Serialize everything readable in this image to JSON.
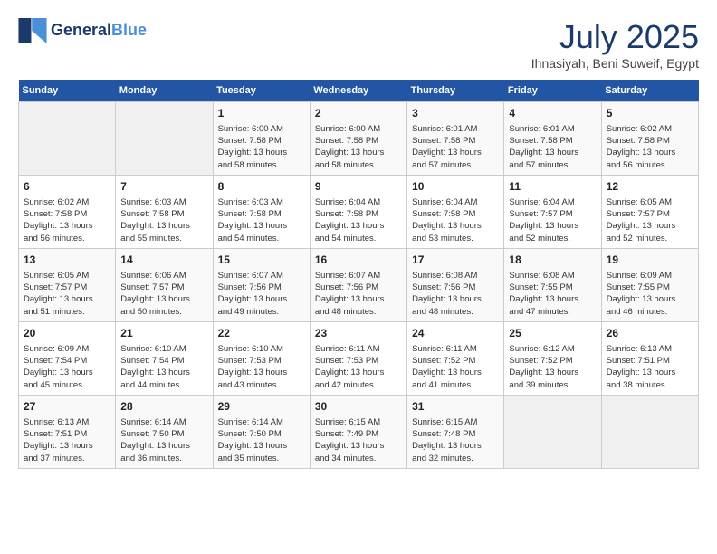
{
  "logo": {
    "line1": "General",
    "line2": "Blue"
  },
  "title": "July 2025",
  "location": "Ihnasiyah, Beni Suweif, Egypt",
  "days_of_week": [
    "Sunday",
    "Monday",
    "Tuesday",
    "Wednesday",
    "Thursday",
    "Friday",
    "Saturday"
  ],
  "weeks": [
    [
      {
        "day": "",
        "info": ""
      },
      {
        "day": "",
        "info": ""
      },
      {
        "day": "1",
        "info": "Sunrise: 6:00 AM\nSunset: 7:58 PM\nDaylight: 13 hours\nand 58 minutes."
      },
      {
        "day": "2",
        "info": "Sunrise: 6:00 AM\nSunset: 7:58 PM\nDaylight: 13 hours\nand 58 minutes."
      },
      {
        "day": "3",
        "info": "Sunrise: 6:01 AM\nSunset: 7:58 PM\nDaylight: 13 hours\nand 57 minutes."
      },
      {
        "day": "4",
        "info": "Sunrise: 6:01 AM\nSunset: 7:58 PM\nDaylight: 13 hours\nand 57 minutes."
      },
      {
        "day": "5",
        "info": "Sunrise: 6:02 AM\nSunset: 7:58 PM\nDaylight: 13 hours\nand 56 minutes."
      }
    ],
    [
      {
        "day": "6",
        "info": "Sunrise: 6:02 AM\nSunset: 7:58 PM\nDaylight: 13 hours\nand 56 minutes."
      },
      {
        "day": "7",
        "info": "Sunrise: 6:03 AM\nSunset: 7:58 PM\nDaylight: 13 hours\nand 55 minutes."
      },
      {
        "day": "8",
        "info": "Sunrise: 6:03 AM\nSunset: 7:58 PM\nDaylight: 13 hours\nand 54 minutes."
      },
      {
        "day": "9",
        "info": "Sunrise: 6:04 AM\nSunset: 7:58 PM\nDaylight: 13 hours\nand 54 minutes."
      },
      {
        "day": "10",
        "info": "Sunrise: 6:04 AM\nSunset: 7:58 PM\nDaylight: 13 hours\nand 53 minutes."
      },
      {
        "day": "11",
        "info": "Sunrise: 6:04 AM\nSunset: 7:57 PM\nDaylight: 13 hours\nand 52 minutes."
      },
      {
        "day": "12",
        "info": "Sunrise: 6:05 AM\nSunset: 7:57 PM\nDaylight: 13 hours\nand 52 minutes."
      }
    ],
    [
      {
        "day": "13",
        "info": "Sunrise: 6:05 AM\nSunset: 7:57 PM\nDaylight: 13 hours\nand 51 minutes."
      },
      {
        "day": "14",
        "info": "Sunrise: 6:06 AM\nSunset: 7:57 PM\nDaylight: 13 hours\nand 50 minutes."
      },
      {
        "day": "15",
        "info": "Sunrise: 6:07 AM\nSunset: 7:56 PM\nDaylight: 13 hours\nand 49 minutes."
      },
      {
        "day": "16",
        "info": "Sunrise: 6:07 AM\nSunset: 7:56 PM\nDaylight: 13 hours\nand 48 minutes."
      },
      {
        "day": "17",
        "info": "Sunrise: 6:08 AM\nSunset: 7:56 PM\nDaylight: 13 hours\nand 48 minutes."
      },
      {
        "day": "18",
        "info": "Sunrise: 6:08 AM\nSunset: 7:55 PM\nDaylight: 13 hours\nand 47 minutes."
      },
      {
        "day": "19",
        "info": "Sunrise: 6:09 AM\nSunset: 7:55 PM\nDaylight: 13 hours\nand 46 minutes."
      }
    ],
    [
      {
        "day": "20",
        "info": "Sunrise: 6:09 AM\nSunset: 7:54 PM\nDaylight: 13 hours\nand 45 minutes."
      },
      {
        "day": "21",
        "info": "Sunrise: 6:10 AM\nSunset: 7:54 PM\nDaylight: 13 hours\nand 44 minutes."
      },
      {
        "day": "22",
        "info": "Sunrise: 6:10 AM\nSunset: 7:53 PM\nDaylight: 13 hours\nand 43 minutes."
      },
      {
        "day": "23",
        "info": "Sunrise: 6:11 AM\nSunset: 7:53 PM\nDaylight: 13 hours\nand 42 minutes."
      },
      {
        "day": "24",
        "info": "Sunrise: 6:11 AM\nSunset: 7:52 PM\nDaylight: 13 hours\nand 41 minutes."
      },
      {
        "day": "25",
        "info": "Sunrise: 6:12 AM\nSunset: 7:52 PM\nDaylight: 13 hours\nand 39 minutes."
      },
      {
        "day": "26",
        "info": "Sunrise: 6:13 AM\nSunset: 7:51 PM\nDaylight: 13 hours\nand 38 minutes."
      }
    ],
    [
      {
        "day": "27",
        "info": "Sunrise: 6:13 AM\nSunset: 7:51 PM\nDaylight: 13 hours\nand 37 minutes."
      },
      {
        "day": "28",
        "info": "Sunrise: 6:14 AM\nSunset: 7:50 PM\nDaylight: 13 hours\nand 36 minutes."
      },
      {
        "day": "29",
        "info": "Sunrise: 6:14 AM\nSunset: 7:50 PM\nDaylight: 13 hours\nand 35 minutes."
      },
      {
        "day": "30",
        "info": "Sunrise: 6:15 AM\nSunset: 7:49 PM\nDaylight: 13 hours\nand 34 minutes."
      },
      {
        "day": "31",
        "info": "Sunrise: 6:15 AM\nSunset: 7:48 PM\nDaylight: 13 hours\nand 32 minutes."
      },
      {
        "day": "",
        "info": ""
      },
      {
        "day": "",
        "info": ""
      }
    ]
  ]
}
